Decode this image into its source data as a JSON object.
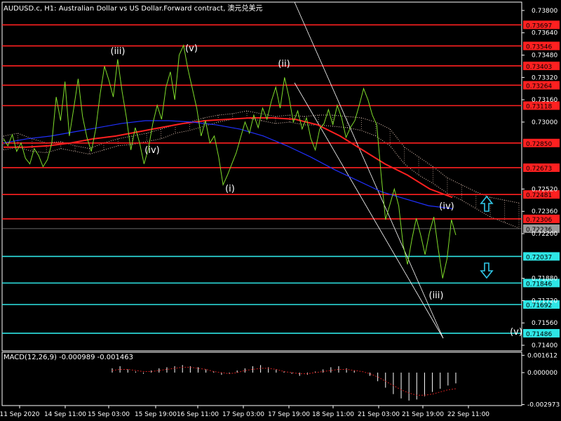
{
  "window": {
    "title": "AUDUSD.c, H1:  Australian Dollar vs US Dollar.Forward contract, 澳元兑美元"
  },
  "colors": {
    "background": "#000000",
    "frame": "#ffffff",
    "price_line": "#7fdc2a",
    "resistance": "#ff2020",
    "support": "#2ee6e6",
    "ichimoku_cloud": "#e8c8b8",
    "ma_red": "#ff2020",
    "ma_blue": "#2030ff",
    "channel": "#ffffff",
    "macd_hist": "#ffffff",
    "macd_signal": "#d02020",
    "up_arrow": "#30c8e8",
    "down_arrow": "#30c8e8"
  },
  "chart_data": {
    "type": "line",
    "title": "AUDUSD.c, H1:  Australian Dollar vs US Dollar.Forward contract, 澳元兑美元",
    "price_axis_ticks": [
      "0.73800",
      "0.73640",
      "0.73480",
      "0.73320",
      "0.73160",
      "0.73000",
      "0.72520",
      "0.72360",
      "0.72200",
      "0.71880",
      "0.71720",
      "0.71560",
      "0.71400"
    ],
    "time_axis_ticks": [
      "11 Sep 2020",
      "14 Sep 11:00",
      "15 Sep 03:00",
      "15 Sep 19:00",
      "16 Sep 11:00",
      "17 Sep 03:00",
      "17 Sep 19:00",
      "18 Sep 11:00",
      "21 Sep 03:00",
      "21 Sep 19:00",
      "22 Sep 11:00"
    ],
    "current_price": "0.72236",
    "resistance_levels": [
      "0.73697",
      "0.73546",
      "0.73403",
      "0.73264",
      "0.73118",
      "0.72850",
      "0.72673",
      "0.72481",
      "0.72306"
    ],
    "support_levels": [
      "0.72037",
      "0.71846",
      "0.71692",
      "0.71486"
    ],
    "wave_labels": [
      "(iii)",
      "(v)",
      "(ii)",
      "(iv)",
      "(i)",
      "(iv)",
      "(iii)",
      "(v)"
    ],
    "price_series": [
      0.7288,
      0.7283,
      0.7291,
      0.7279,
      0.7285,
      0.7274,
      0.727,
      0.7281,
      0.7276,
      0.7268,
      0.7273,
      0.7285,
      0.7318,
      0.7301,
      0.7329,
      0.729,
      0.731,
      0.7331,
      0.7304,
      0.7289,
      0.7279,
      0.7295,
      0.732,
      0.734,
      0.733,
      0.7318,
      0.7345,
      0.7322,
      0.7303,
      0.728,
      0.7296,
      0.7285,
      0.727,
      0.7281,
      0.7299,
      0.7312,
      0.7302,
      0.7325,
      0.7336,
      0.7316,
      0.7348,
      0.7355,
      0.7338,
      0.7324,
      0.731,
      0.729,
      0.7301,
      0.7285,
      0.729,
      0.7275,
      0.7255,
      0.7262,
      0.727,
      0.7278,
      0.7289,
      0.73,
      0.7292,
      0.7305,
      0.7296,
      0.731,
      0.7302,
      0.7315,
      0.7325,
      0.731,
      0.7332,
      0.7318,
      0.73,
      0.7308,
      0.7295,
      0.7303,
      0.7288,
      0.728,
      0.7295,
      0.7299,
      0.7309,
      0.7298,
      0.7312,
      0.7303,
      0.7289,
      0.7296,
      0.7301,
      0.7312,
      0.7324,
      0.7316,
      0.7305,
      0.7298,
      0.7262,
      0.723,
      0.7241,
      0.7252,
      0.724,
      0.7212,
      0.7198,
      0.7216,
      0.7231,
      0.7219,
      0.7205,
      0.7221,
      0.7232,
      0.7209,
      0.7188,
      0.7202,
      0.723,
      0.7219
    ],
    "ichimoku_upper": [
      0.729,
      0.7292,
      0.7288,
      0.7285,
      0.7286,
      0.7283,
      0.7281,
      0.7285,
      0.7288,
      0.729,
      0.7292,
      0.7295,
      0.7298,
      0.73,
      0.7303,
      0.7305,
      0.7306,
      0.7308,
      0.7306,
      0.7304,
      0.7305,
      0.7304,
      0.7305,
      0.7305,
      0.7304,
      0.7303,
      0.73,
      0.7295,
      0.7282,
      0.7275,
      0.7268,
      0.726,
      0.7255,
      0.725,
      0.7246,
      0.7244,
      0.7242
    ],
    "ichimoku_lower": [
      0.728,
      0.7282,
      0.7279,
      0.7278,
      0.7281,
      0.7279,
      0.7277,
      0.728,
      0.7283,
      0.7284,
      0.7286,
      0.7288,
      0.7292,
      0.7294,
      0.7297,
      0.73,
      0.7302,
      0.7303,
      0.7301,
      0.7299,
      0.73,
      0.7298,
      0.7298,
      0.7297,
      0.7296,
      0.7294,
      0.729,
      0.7283,
      0.727,
      0.7262,
      0.7256,
      0.7249,
      0.7244,
      0.7238,
      0.7232,
      0.7228,
      0.7224
    ],
    "ma_red": [
      0.7282,
      0.7282,
      0.7283,
      0.7285,
      0.7288,
      0.729,
      0.7293,
      0.7296,
      0.7299,
      0.7301,
      0.7302,
      0.7303,
      0.7303,
      0.7302,
      0.7298,
      0.729,
      0.728,
      0.727,
      0.7262,
      0.7252,
      0.7246
    ],
    "ma_blue": [
      0.7285,
      0.7288,
      0.729,
      0.7293,
      0.7296,
      0.7299,
      0.7301,
      0.7301,
      0.73,
      0.7298,
      0.7295,
      0.729,
      0.7283,
      0.7275,
      0.7266,
      0.7258,
      0.725,
      0.7245,
      0.724,
      0.7238
    ],
    "macd": {
      "label": "MACD(12,26,9)",
      "main_value": "-0.000989",
      "signal_value": "-0.001463",
      "axis_ticks": [
        "0.001612",
        "0.000000",
        "-0.002973"
      ],
      "histogram": [
        0.0004,
        0.0006,
        0.0003,
        0.0001,
        -0.0001,
        0.0002,
        0.0004,
        0.0005,
        0.0006,
        0.0007,
        0.0006,
        0.0005,
        0.0003,
        0.0001,
        -0.0002,
        -0.0001,
        0.0002,
        0.0004,
        0.0006,
        0.0007,
        0.0005,
        0.0003,
        0.0001,
        -0.0001,
        -0.0003,
        -0.0002,
        0.0001,
        0.0003,
        0.0005,
        0.0006,
        0.0004,
        0.0002,
        0.0,
        -0.0003,
        -0.0008,
        -0.0014,
        -0.002,
        -0.0024,
        -0.0026,
        -0.0025,
        -0.0022,
        -0.0018,
        -0.0015,
        -0.0012,
        -0.001
      ],
      "signal": [
        0.0002,
        0.0003,
        0.0003,
        0.0002,
        0.0001,
        0.0001,
        0.0002,
        0.0003,
        0.0004,
        0.0005,
        0.0005,
        0.0004,
        0.0003,
        0.0001,
        0.0,
        -0.0001,
        0.0,
        0.0002,
        0.0003,
        0.0004,
        0.0004,
        0.0003,
        0.0001,
        0.0,
        -0.0001,
        -0.0001,
        0.0,
        0.0001,
        0.0002,
        0.0003,
        0.0003,
        0.0002,
        0.0001,
        -0.0001,
        -0.0004,
        -0.0008,
        -0.0012,
        -0.0016,
        -0.0019,
        -0.0021,
        -0.0021,
        -0.002,
        -0.0018,
        -0.0016,
        -0.0015
      ]
    }
  }
}
